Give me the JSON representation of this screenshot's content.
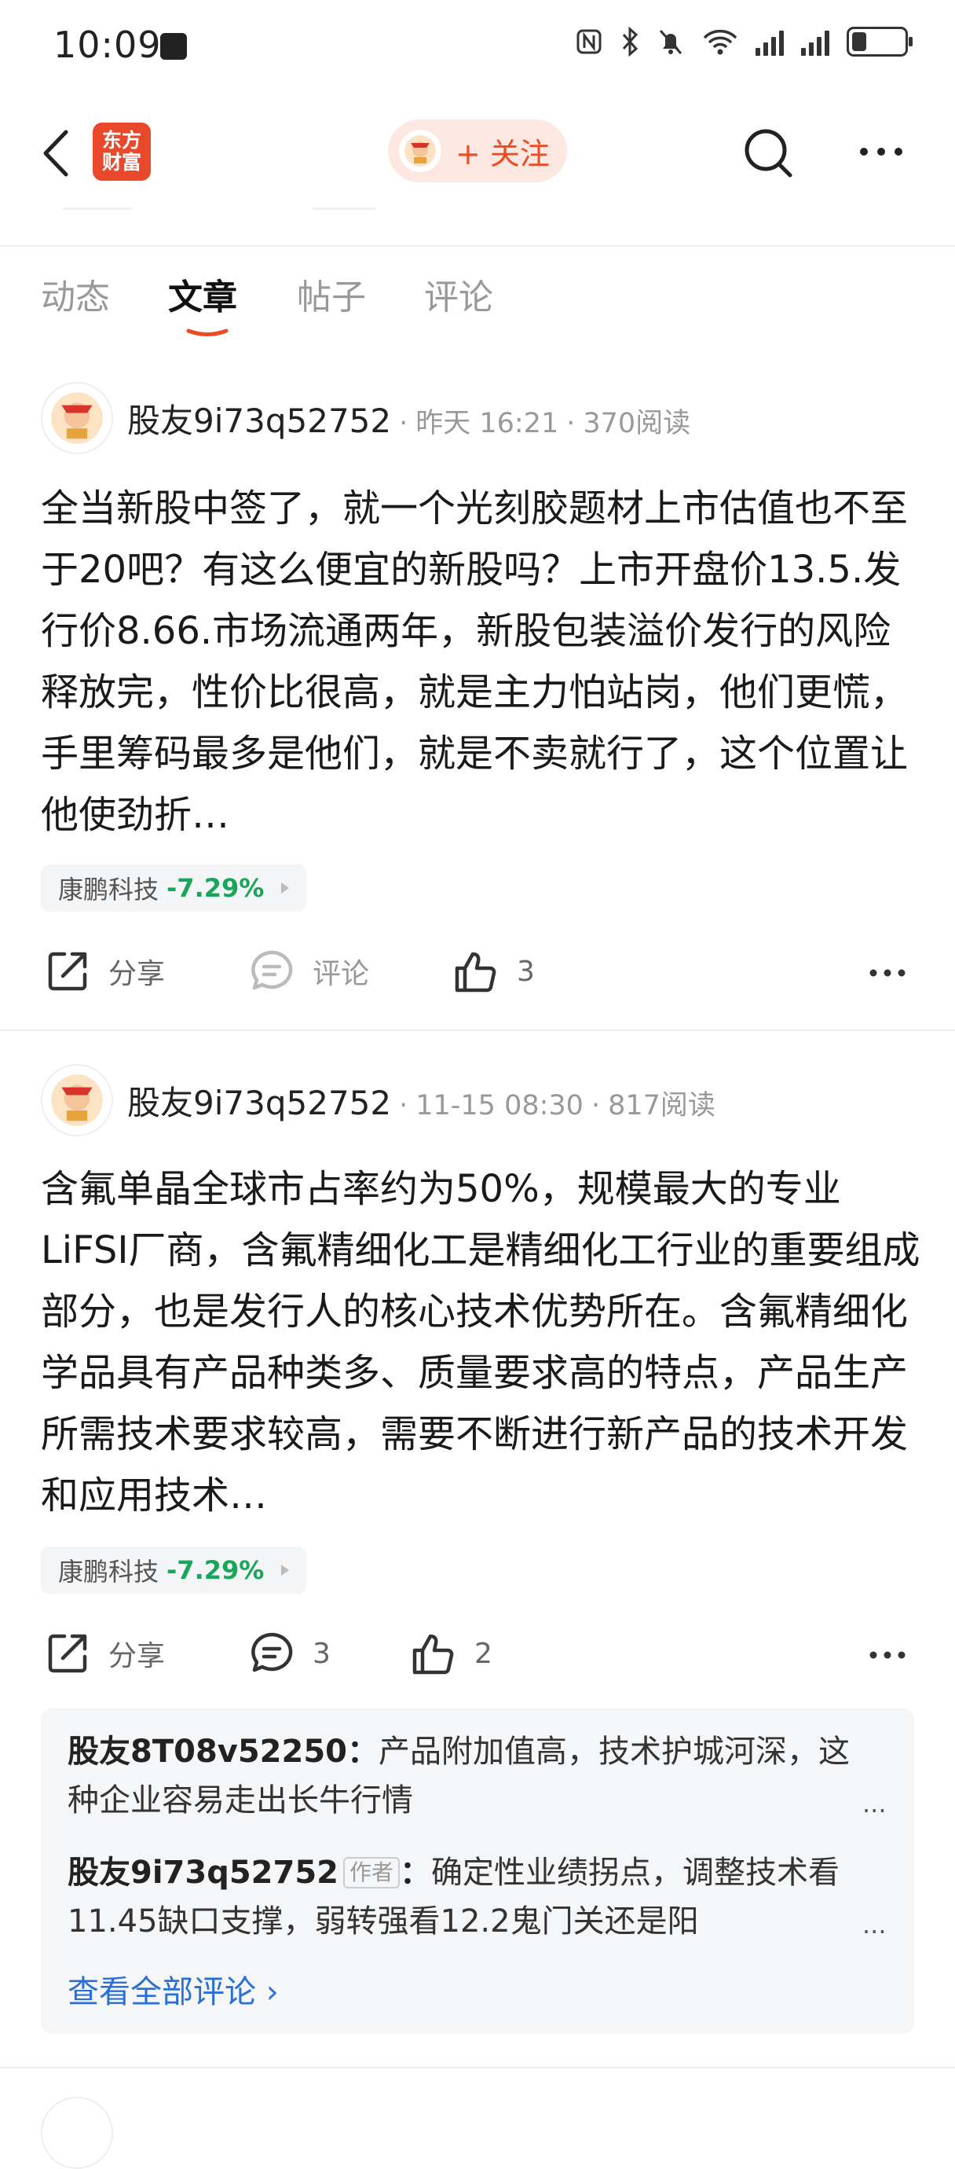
{
  "status_bar": {
    "time": "10:09"
  },
  "header": {
    "logo_text_top": "东方",
    "logo_text_bottom": "财富",
    "follow_label": "+ 关注"
  },
  "tabs": [
    "动态",
    "文章",
    "帖子",
    "评论"
  ],
  "posts": [
    {
      "author": "股友9i73q52752",
      "time": "昨天 16:21",
      "reads": "370阅读",
      "text": "全当新股中签了，就一个光刻胶题材上市估值也不至于20吧？有这么便宜的新股吗？上市开盘价13.5.发行价8.66.市场流通两年，新股包装溢价发行的风险释放完，性价比很高，就是主力怕站岗，他们更慌，手里筹码最多是他们，就是不卖就行了，这个位置让他使劲折…",
      "stock_name": "康鹏科技",
      "stock_change": "-7.29%",
      "share_label": "分享",
      "comment_label": "评论",
      "likes": "3"
    },
    {
      "author": "股友9i73q52752",
      "time": "11-15 08:30",
      "reads": "817阅读",
      "text": "含氟单晶全球市占率约为50%，规模最大的专业LiFSI厂商，含氟精细化工是精细化工行业的重要组成部分，也是发行人的核心技术优势所在。含氟精细化学品具有产品种类多、质量要求高的特点，产品生产所需技术要求较高，需要不断进行新产品的技术开发和应用技术…",
      "stock_name": "康鹏科技",
      "stock_change": "-7.29%",
      "share_label": "分享",
      "comment_count": "3",
      "likes": "2",
      "comments": [
        {
          "name": "股友8T08v52250",
          "sep": "：",
          "text": "产品附加值高，技术护城河深，这种企业容易走出长牛行情"
        },
        {
          "name": "股友9i73q52752",
          "badge": "作者",
          "sep": "：",
          "text": "确定性业绩拐点，调整技术看11.45缺口支撑，弱转强看12.2鬼门关还是阳"
        }
      ],
      "more_dots": "...",
      "view_all": "查看全部评论 ›"
    }
  ],
  "colors": {
    "accent": "#ee4a23",
    "stock_down": "#1aa65a",
    "link": "#2a6fd6"
  },
  "icons": [
    "back-icon",
    "search-icon",
    "more-icon",
    "share-icon",
    "comment-icon",
    "like-icon"
  ]
}
